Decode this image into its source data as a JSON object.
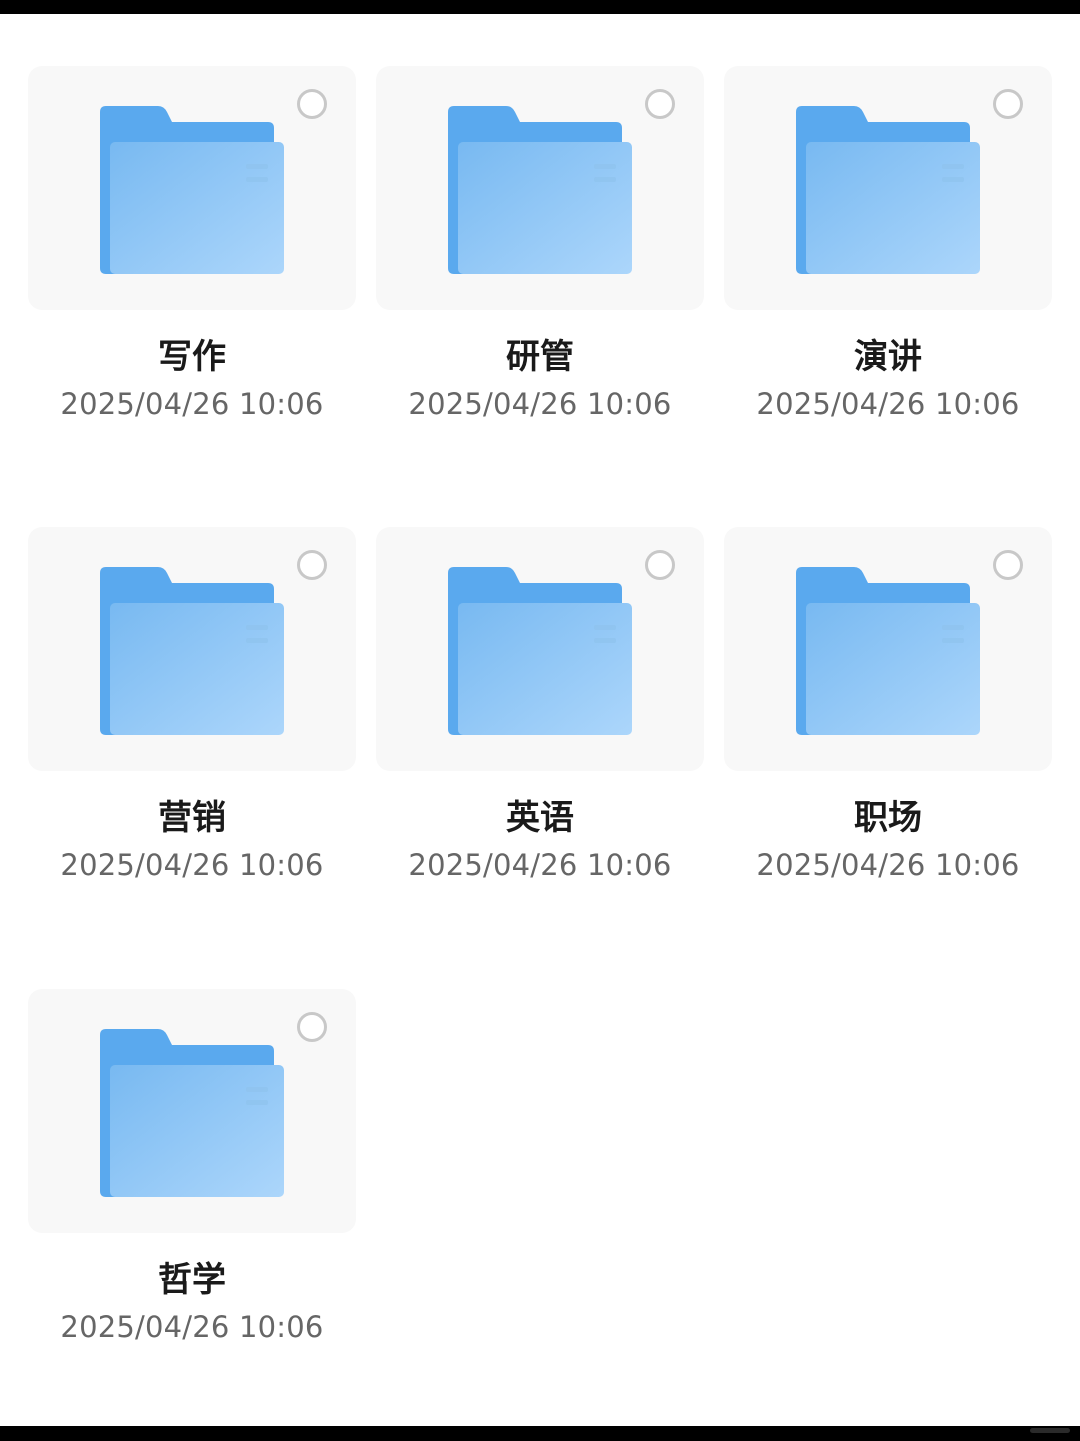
{
  "folders": [
    {
      "name": "写作",
      "date": "2025/04/26 10:06"
    },
    {
      "name": "研管",
      "date": "2025/04/26 10:06"
    },
    {
      "name": "演讲",
      "date": "2025/04/26 10:06"
    },
    {
      "name": "营销",
      "date": "2025/04/26 10:06"
    },
    {
      "name": "英语",
      "date": "2025/04/26 10:06"
    },
    {
      "name": "职场",
      "date": "2025/04/26 10:06"
    },
    {
      "name": "哲学",
      "date": "2025/04/26 10:06"
    }
  ],
  "icons": {
    "folder": "folder-icon",
    "select": "select-circle-icon"
  },
  "colors": {
    "folder_back": "#5aa9ee",
    "folder_front_start": "#7cbcf2",
    "folder_front_end": "#a9d4fa",
    "thumb_bg": "#f8f8f8",
    "name_text": "#1a1a1a",
    "date_text": "#666666"
  }
}
